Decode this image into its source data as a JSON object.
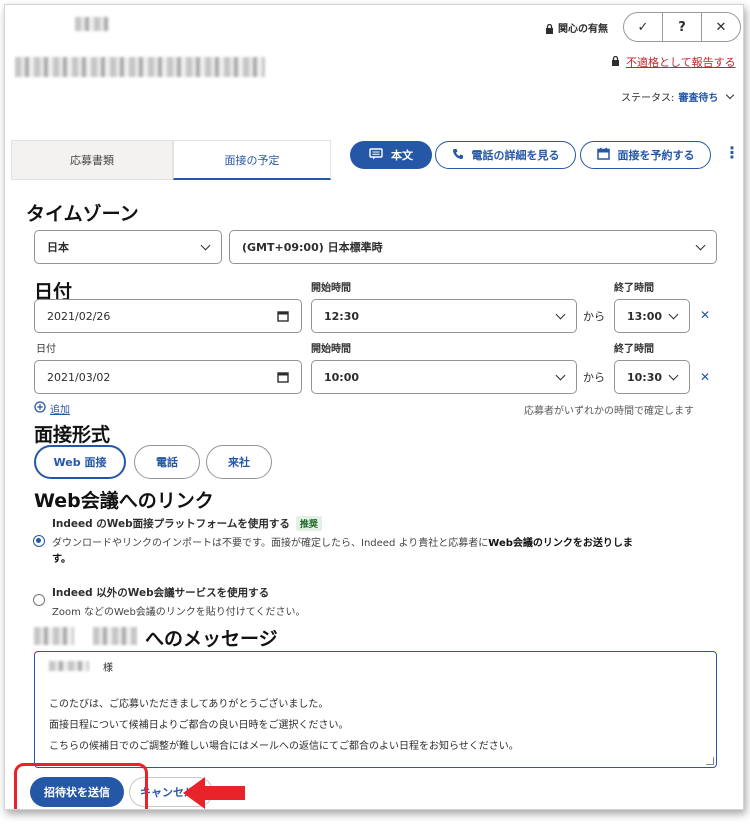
{
  "header": {
    "interest_label": "関心の有無",
    "check_glyph": "✓",
    "question_glyph": "?",
    "close_glyph": "✕",
    "report_link": "不適格として報告する",
    "status_label": "ステータス:",
    "status_value": "審査待ち"
  },
  "tabs": [
    {
      "label": "応募書類"
    },
    {
      "label": "面接の予定"
    }
  ],
  "actions": {
    "main_text": "本文",
    "phone_details": "電話の詳細を見る",
    "schedule_interview": "面接を予約する",
    "more_glyph": "⋮"
  },
  "timezone": {
    "heading": "タイムゾーン",
    "country": "日本",
    "zone": "(GMT+09:00) 日本標準時"
  },
  "date_section": {
    "heading": "日付",
    "sub_label": "日付",
    "start_label": "開始時間",
    "end_label": "終了時間",
    "from_label": "から",
    "rows": [
      {
        "date": "2021/02/26",
        "start": "12:30",
        "end": "13:00"
      },
      {
        "date": "2021/03/02",
        "start": "10:00",
        "end": "10:30"
      }
    ],
    "add_label": "追加",
    "confirm_note": "応募者がいずれかの時間で確定します"
  },
  "format": {
    "heading": "面接形式",
    "options": [
      "Web 面接",
      "電話",
      "来社"
    ]
  },
  "weblink": {
    "heading": "Web会議へのリンク",
    "option1_title": "Indeed のWeb面接プラットフォームを使用する",
    "option1_badge": "推奨",
    "option1_desc_a": "ダウンロードやリンクのインポートは不要です。面接が確定したら、Indeed より貴社と応募者に",
    "option1_desc_b": "Web会議のリンクをお送りしま",
    "option1_desc_c": "す。",
    "option2_title": "Indeed 以外のWeb会議サービスを使用する",
    "option2_desc": "Zoom などのWeb会議のリンクを貼り付けてください。"
  },
  "message": {
    "heading_suffix": "へのメッセージ",
    "salutation": "様",
    "line1": "このたびは、ご応募いただきましてありがとうございました。",
    "line2": "面接日程について候補日よりご都合の良い日時をご選択ください。",
    "line3": "こちらの候補日でのご調整が難しい場合にはメールへの返信にてご都合のよい日程をお知らせください。"
  },
  "footer": {
    "send_label": "招待状を送信",
    "cancel_label": "キャンセル"
  },
  "colors": {
    "accent": "#2557a7",
    "annotation_red": "#e8232a",
    "recommend_badge": "#e4f0e3"
  }
}
